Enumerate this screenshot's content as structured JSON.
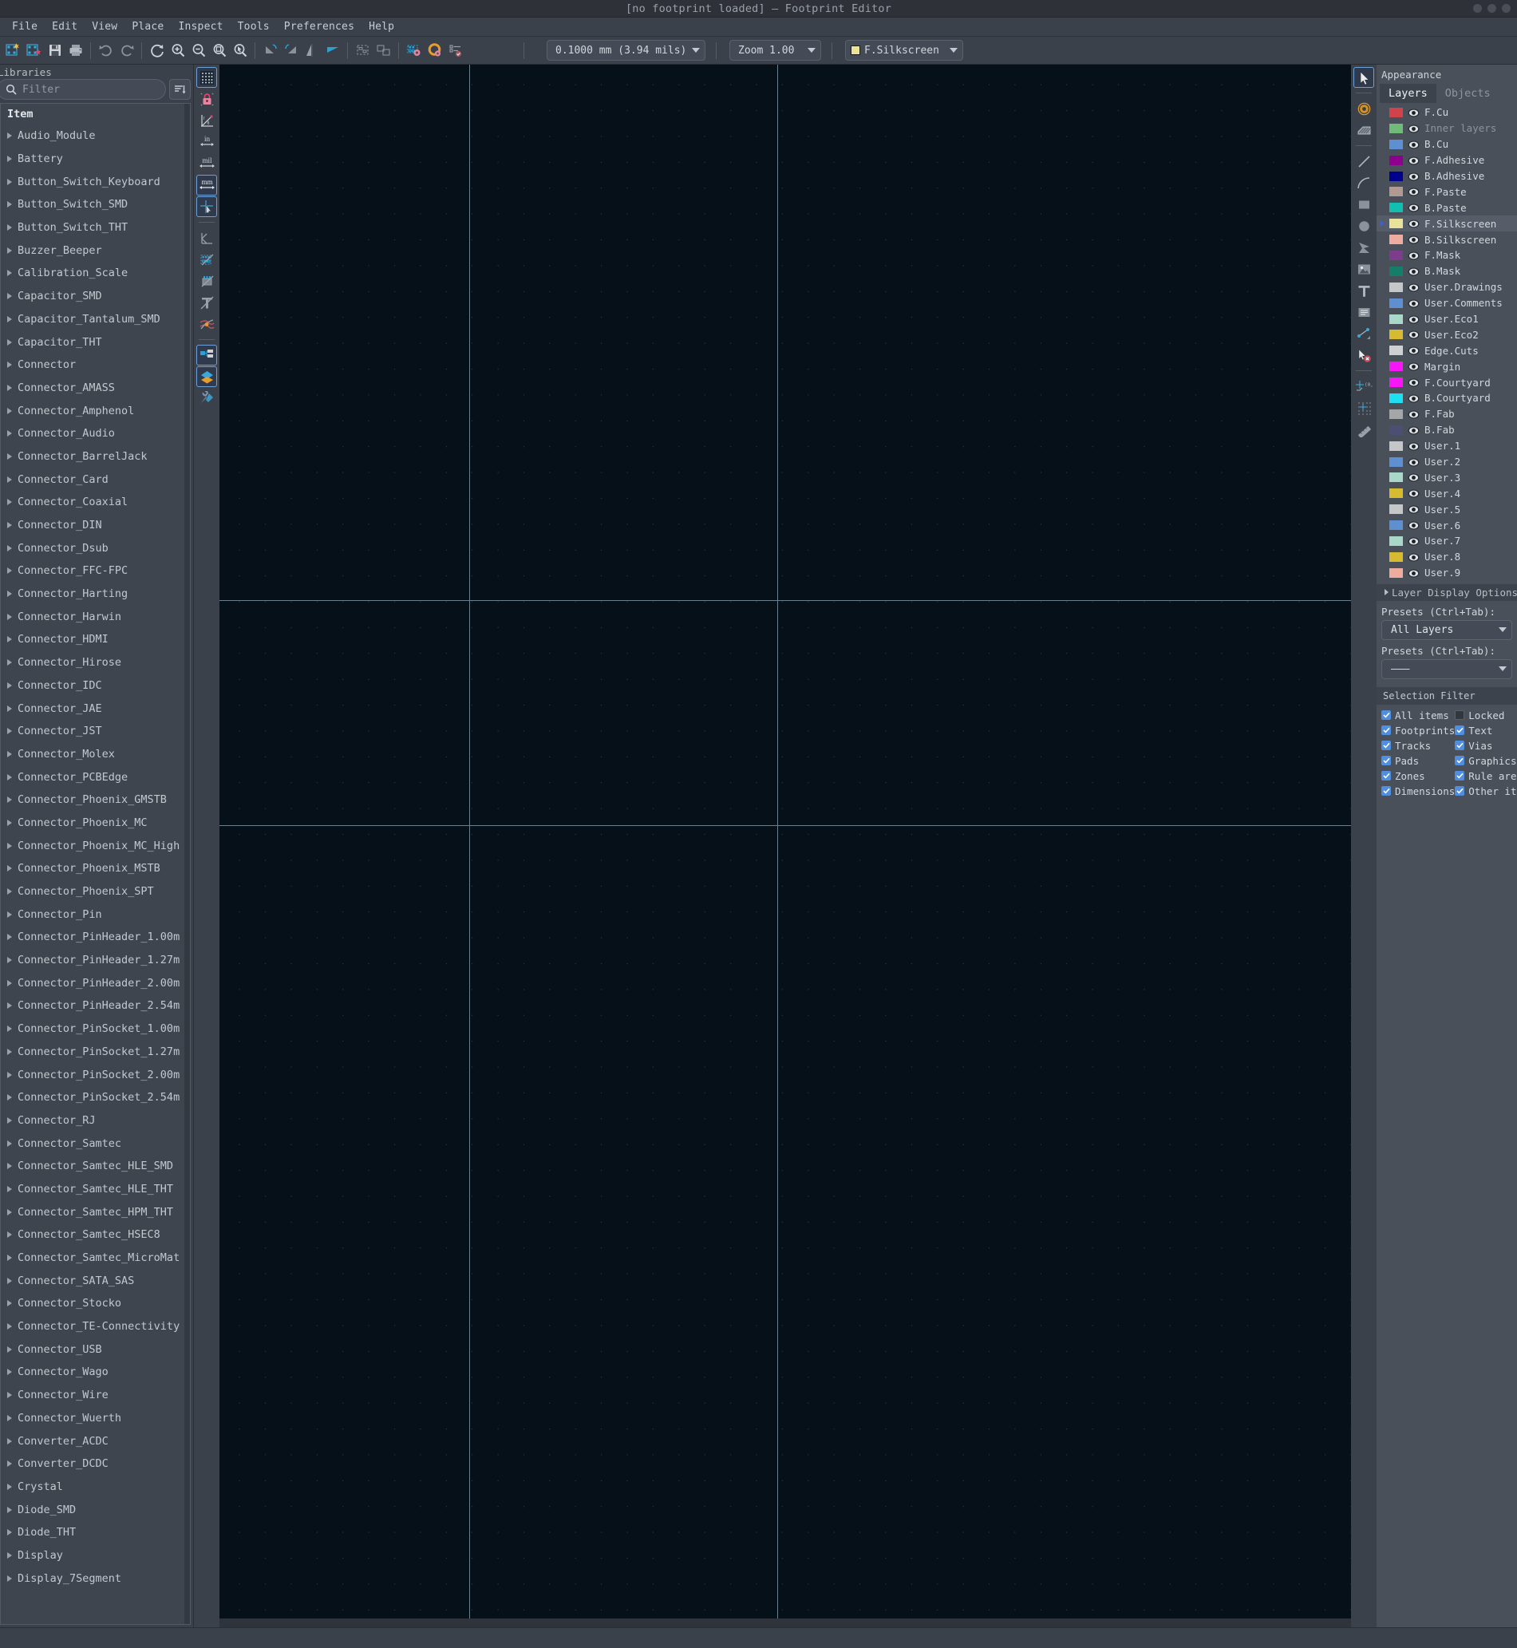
{
  "window": {
    "title": "[no footprint loaded] — Footprint Editor",
    "minimize_label": "–",
    "maximize_label": "□",
    "close_label": "×"
  },
  "menubar": {
    "items": [
      {
        "label": "File"
      },
      {
        "label": "Edit"
      },
      {
        "label": "View"
      },
      {
        "label": "Place"
      },
      {
        "label": "Inspect"
      },
      {
        "label": "Tools"
      },
      {
        "label": "Preferences"
      },
      {
        "label": "Help"
      }
    ]
  },
  "toolbar": {
    "buttons": [
      {
        "name": "new-footprint-icon",
        "title": "New footprint"
      },
      {
        "name": "save-to-library-icon",
        "title": "Save to library"
      },
      {
        "name": "save-icon",
        "title": "Save"
      },
      {
        "name": "print-icon",
        "title": "Print"
      },
      {
        "name": "undo-icon",
        "title": "Undo"
      },
      {
        "name": "redo-icon",
        "title": "Redo"
      },
      {
        "name": "refresh-icon",
        "title": "Refresh"
      },
      {
        "name": "zoom-in-icon",
        "title": "Zoom in"
      },
      {
        "name": "zoom-out-icon",
        "title": "Zoom out"
      },
      {
        "name": "zoom-fit-icon",
        "title": "Zoom to fit"
      },
      {
        "name": "zoom-select-icon",
        "title": "Zoom to selection"
      },
      {
        "name": "rotate-ccw-icon",
        "title": "Rotate counterclockwise"
      },
      {
        "name": "rotate-cw-icon",
        "title": "Rotate clockwise"
      },
      {
        "name": "mirror-horizontal-icon",
        "title": "Mirror horizontally"
      },
      {
        "name": "mirror-vertical-icon",
        "title": "Mirror vertically"
      },
      {
        "name": "footprint-properties-icon",
        "title": "Footprint properties"
      },
      {
        "name": "default-pad-properties-icon",
        "title": "Default pad properties"
      },
      {
        "name": "pad-settings-icon",
        "title": "Pad settings"
      },
      {
        "name": "footprint-checker-icon",
        "title": "Footprint checker"
      },
      {
        "name": "load-footprint-icon",
        "title": "Load footprint"
      }
    ],
    "grid_value": "0.1000 mm (3.94 mils)",
    "zoom_value": "Zoom 1.00",
    "layer_value": "F.Silkscreen",
    "layer_color": "#e8e29a"
  },
  "libraries": {
    "caption": "Libraries",
    "filter_placeholder": "Filter",
    "filter_value": "",
    "search_icon": "search-icon",
    "sort_icon": "sort-list-icon",
    "column_header": "Item",
    "items": [
      {
        "label": "Audio_Module"
      },
      {
        "label": "Battery"
      },
      {
        "label": "Button_Switch_Keyboard"
      },
      {
        "label": "Button_Switch_SMD"
      },
      {
        "label": "Button_Switch_THT"
      },
      {
        "label": "Buzzer_Beeper"
      },
      {
        "label": "Calibration_Scale"
      },
      {
        "label": "Capacitor_SMD"
      },
      {
        "label": "Capacitor_Tantalum_SMD"
      },
      {
        "label": "Capacitor_THT"
      },
      {
        "label": "Connector"
      },
      {
        "label": "Connector_AMASS"
      },
      {
        "label": "Connector_Amphenol"
      },
      {
        "label": "Connector_Audio"
      },
      {
        "label": "Connector_BarrelJack"
      },
      {
        "label": "Connector_Card"
      },
      {
        "label": "Connector_Coaxial"
      },
      {
        "label": "Connector_DIN"
      },
      {
        "label": "Connector_Dsub"
      },
      {
        "label": "Connector_FFC-FPC"
      },
      {
        "label": "Connector_Harting"
      },
      {
        "label": "Connector_Harwin"
      },
      {
        "label": "Connector_HDMI"
      },
      {
        "label": "Connector_Hirose"
      },
      {
        "label": "Connector_IDC"
      },
      {
        "label": "Connector_JAE"
      },
      {
        "label": "Connector_JST"
      },
      {
        "label": "Connector_Molex"
      },
      {
        "label": "Connector_PCBEdge"
      },
      {
        "label": "Connector_Phoenix_GMSTB"
      },
      {
        "label": "Connector_Phoenix_MC"
      },
      {
        "label": "Connector_Phoenix_MC_High"
      },
      {
        "label": "Connector_Phoenix_MSTB"
      },
      {
        "label": "Connector_Phoenix_SPT"
      },
      {
        "label": "Connector_Pin"
      },
      {
        "label": "Connector_PinHeader_1.00m"
      },
      {
        "label": "Connector_PinHeader_1.27m"
      },
      {
        "label": "Connector_PinHeader_2.00m"
      },
      {
        "label": "Connector_PinHeader_2.54m"
      },
      {
        "label": "Connector_PinSocket_1.00m"
      },
      {
        "label": "Connector_PinSocket_1.27m"
      },
      {
        "label": "Connector_PinSocket_2.00m"
      },
      {
        "label": "Connector_PinSocket_2.54m"
      },
      {
        "label": "Connector_RJ"
      },
      {
        "label": "Connector_Samtec"
      },
      {
        "label": "Connector_Samtec_HLE_SMD"
      },
      {
        "label": "Connector_Samtec_HLE_THT"
      },
      {
        "label": "Connector_Samtec_HPM_THT"
      },
      {
        "label": "Connector_Samtec_HSEC8"
      },
      {
        "label": "Connector_Samtec_MicroMat"
      },
      {
        "label": "Connector_SATA_SAS"
      },
      {
        "label": "Connector_Stocko"
      },
      {
        "label": "Connector_TE-Connectivity"
      },
      {
        "label": "Connector_USB"
      },
      {
        "label": "Connector_Wago"
      },
      {
        "label": "Connector_Wire"
      },
      {
        "label": "Connector_Wuerth"
      },
      {
        "label": "Converter_ACDC"
      },
      {
        "label": "Converter_DCDC"
      },
      {
        "label": "Crystal"
      },
      {
        "label": "Diode_SMD"
      },
      {
        "label": "Diode_THT"
      },
      {
        "label": "Display"
      },
      {
        "label": "Display_7Segment"
      }
    ]
  },
  "left_tools": [
    {
      "name": "grid-icon",
      "active": false
    },
    {
      "name": "lock-grid-icon",
      "active": false
    },
    {
      "name": "polar-coords-icon",
      "active": false
    },
    {
      "name": "units-inches-icon",
      "label": "in",
      "active": false
    },
    {
      "name": "units-mils-icon",
      "label": "mil",
      "active": false
    },
    {
      "name": "units-mm-icon",
      "label": "mm",
      "active": true
    },
    {
      "name": "full-crosshair-icon",
      "active": true
    },
    {
      "name": "datum-point-icon",
      "active": false
    },
    {
      "name": "show-pads-sketch-icon",
      "active": false
    },
    {
      "name": "show-footprint-sketch-icon",
      "active": false
    },
    {
      "name": "show-text-sketch-icon",
      "active": false
    },
    {
      "name": "high-contrast-icon",
      "active": false
    },
    {
      "name": "show-hierarchy-icon",
      "active": true
    },
    {
      "name": "properties-manager-icon",
      "active": true
    },
    {
      "name": "scripting-console-icon",
      "active": false
    }
  ],
  "right_tools": [
    {
      "name": "select-cursor-icon",
      "active": true
    },
    {
      "name": "add-pad-icon",
      "active": false
    },
    {
      "name": "add-zone-icon",
      "active": false
    },
    {
      "name": "draw-line-icon",
      "active": false
    },
    {
      "name": "draw-arc-icon",
      "active": false
    },
    {
      "name": "draw-rectangle-icon",
      "active": false
    },
    {
      "name": "draw-circle-icon",
      "active": false
    },
    {
      "name": "draw-polygon-icon",
      "active": false
    },
    {
      "name": "add-image-icon",
      "active": false
    },
    {
      "name": "add-text-icon",
      "active": false
    },
    {
      "name": "add-textbox-icon",
      "active": false
    },
    {
      "name": "add-dimension-icon",
      "active": false
    },
    {
      "name": "delete-item-icon",
      "active": false
    },
    {
      "name": "set-origin-icon",
      "active": false
    },
    {
      "name": "grid-origin-icon",
      "active": false
    },
    {
      "name": "measure-tool-icon",
      "active": false
    }
  ],
  "appearance": {
    "title": "Appearance",
    "tabs": [
      {
        "label": "Layers",
        "active": true
      },
      {
        "label": "Objects",
        "active": false
      }
    ],
    "layers": [
      {
        "label": "F.Cu",
        "color": "#d1434a",
        "selected": false,
        "dim": false
      },
      {
        "label": "Inner layers",
        "color": "#6fbb77",
        "selected": false,
        "dim": true
      },
      {
        "label": "B.Cu",
        "color": "#5d8fd1",
        "selected": false,
        "dim": false
      },
      {
        "label": "F.Adhesive",
        "color": "#8e018e",
        "selected": false,
        "dim": false
      },
      {
        "label": "B.Adhesive",
        "color": "#00008f",
        "selected": false,
        "dim": false
      },
      {
        "label": "F.Paste",
        "color": "#b09a92",
        "selected": false,
        "dim": false
      },
      {
        "label": "B.Paste",
        "color": "#10bfb0",
        "selected": false,
        "dim": false
      },
      {
        "label": "F.Silkscreen",
        "color": "#e8e29a",
        "selected": true,
        "dim": false
      },
      {
        "label": "B.Silkscreen",
        "color": "#eeac9e",
        "selected": false,
        "dim": false
      },
      {
        "label": "F.Mask",
        "color": "#7b3d8c",
        "selected": false,
        "dim": false
      },
      {
        "label": "B.Mask",
        "color": "#147e6a",
        "selected": false,
        "dim": false
      },
      {
        "label": "User.Drawings",
        "color": "#c5c6c7",
        "selected": false,
        "dim": false
      },
      {
        "label": "User.Comments",
        "color": "#5d8fd1",
        "selected": false,
        "dim": false
      },
      {
        "label": "User.Eco1",
        "color": "#a8d8c7",
        "selected": false,
        "dim": false
      },
      {
        "label": "User.Eco2",
        "color": "#d6bb31",
        "selected": false,
        "dim": false
      },
      {
        "label": "Edge.Cuts",
        "color": "#cfd0d1",
        "selected": false,
        "dim": false
      },
      {
        "label": "Margin",
        "color": "#f816f8",
        "selected": false,
        "dim": false
      },
      {
        "label": "F.Courtyard",
        "color": "#f816f8",
        "selected": false,
        "dim": false
      },
      {
        "label": "B.Courtyard",
        "color": "#1ce0f2",
        "selected": false,
        "dim": false
      },
      {
        "label": "F.Fab",
        "color": "#a4a6a8",
        "selected": false,
        "dim": false
      },
      {
        "label": "B.Fab",
        "color": "#4a4f73",
        "selected": false,
        "dim": false
      },
      {
        "label": "User.1",
        "color": "#c5c6c7",
        "selected": false,
        "dim": false
      },
      {
        "label": "User.2",
        "color": "#5d8fd1",
        "selected": false,
        "dim": false
      },
      {
        "label": "User.3",
        "color": "#a8d8c7",
        "selected": false,
        "dim": false
      },
      {
        "label": "User.4",
        "color": "#d6bb31",
        "selected": false,
        "dim": false
      },
      {
        "label": "User.5",
        "color": "#c5c6c7",
        "selected": false,
        "dim": false
      },
      {
        "label": "User.6",
        "color": "#5d8fd1",
        "selected": false,
        "dim": false
      },
      {
        "label": "User.7",
        "color": "#a8d8c7",
        "selected": false,
        "dim": false
      },
      {
        "label": "User.8",
        "color": "#d6bb31",
        "selected": false,
        "dim": false
      },
      {
        "label": "User.9",
        "color": "#eeac9e",
        "selected": false,
        "dim": false
      }
    ],
    "layer_display_options": "Layer Display Options",
    "presets": [
      {
        "label": "Presets (Ctrl+Tab):",
        "value": "All Layers"
      },
      {
        "label": "Presets (Ctrl+Tab):",
        "value": "———"
      }
    ],
    "selection_filter": {
      "title": "Selection Filter",
      "items": [
        {
          "label": "All items",
          "checked": true
        },
        {
          "label": "Locked",
          "checked": false
        },
        {
          "label": "Footprints",
          "checked": true
        },
        {
          "label": "Text",
          "checked": true
        },
        {
          "label": "Tracks",
          "checked": true
        },
        {
          "label": "Vias",
          "checked": true
        },
        {
          "label": "Pads",
          "checked": true
        },
        {
          "label": "Graphics",
          "checked": true
        },
        {
          "label": "Zones",
          "checked": true
        },
        {
          "label": "Rule areas",
          "checked": true
        },
        {
          "label": "Dimensions",
          "checked": true
        },
        {
          "label": "Other items",
          "checked": true
        }
      ]
    }
  },
  "statusbar": {
    "text": ""
  }
}
